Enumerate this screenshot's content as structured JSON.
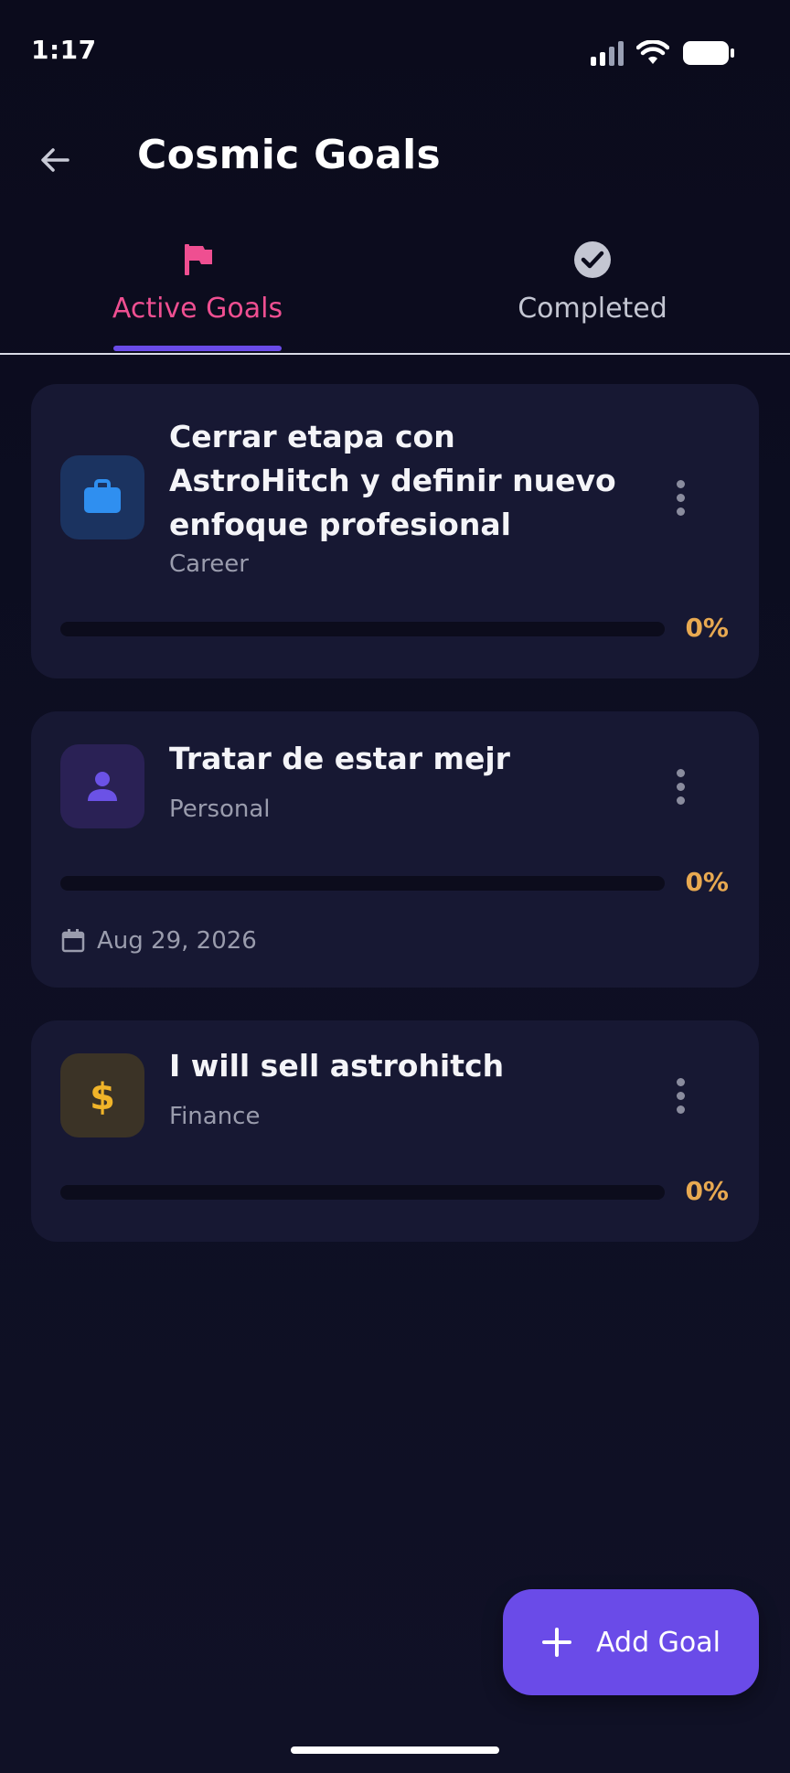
{
  "status_bar": {
    "time": "1:17",
    "signal_bars": 2
  },
  "header": {
    "title": "Cosmic Goals",
    "back_icon": "arrow-left-icon"
  },
  "tabs": [
    {
      "label": "Active Goals",
      "icon": "flag-icon",
      "active": true,
      "color": "#ef4f91"
    },
    {
      "label": "Completed",
      "icon": "check-circle-icon",
      "active": false,
      "color": "#c4c6d2"
    }
  ],
  "goals": [
    {
      "title": "Cerrar etapa con AstroHitch y definir nuevo enfoque profesional",
      "category": "Career",
      "icon": "briefcase-icon",
      "icon_color": "#2f8ff0",
      "icon_bg": "#1b3360",
      "progress": 0,
      "progress_label": "0%",
      "due_date": ""
    },
    {
      "title": "Tratar de estar mejr",
      "category": "Personal",
      "icon": "person-icon",
      "icon_color": "#6b52e6",
      "icon_bg": "#2a2155",
      "progress": 0,
      "progress_label": "0%",
      "due_date": "Aug 29, 2026"
    },
    {
      "title": "I will sell astrohitch",
      "category": "Finance",
      "icon": "dollar-icon",
      "icon_color": "#f0b429",
      "icon_bg": "#3b3326",
      "progress": 0,
      "progress_label": "0%",
      "due_date": ""
    }
  ],
  "fab": {
    "label": "Add Goal",
    "icon": "plus-icon"
  },
  "colors": {
    "accent": "#6a4be8",
    "progress": "#e8a951",
    "active_tab": "#ef4f91",
    "card": "#171833"
  }
}
